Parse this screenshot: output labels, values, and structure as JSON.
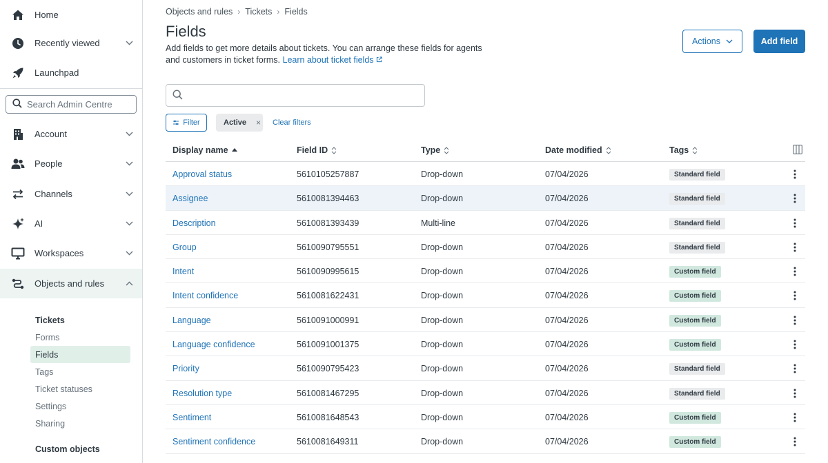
{
  "sidebar": {
    "items": [
      {
        "label": "Home",
        "icon": "home-icon"
      },
      {
        "label": "Recently viewed",
        "icon": "clock-icon"
      },
      {
        "label": "Launchpad",
        "icon": "rocket-icon"
      },
      {
        "label": "Account",
        "icon": "building-icon"
      },
      {
        "label": "People",
        "icon": "people-icon"
      },
      {
        "label": "Channels",
        "icon": "arrows-icon"
      },
      {
        "label": "AI",
        "icon": "sparkle-icon"
      },
      {
        "label": "Workspaces",
        "icon": "monitor-icon"
      },
      {
        "label": "Objects and rules",
        "icon": "objects-icon"
      }
    ],
    "search_placeholder": "Search Admin Centre",
    "section_tickets": "Tickets",
    "sub_items": [
      "Forms",
      "Fields",
      "Tags",
      "Ticket statuses",
      "Settings",
      "Sharing"
    ],
    "section_custom": "Custom objects"
  },
  "breadcrumb": [
    "Objects and rules",
    "Tickets",
    "Fields"
  ],
  "page": {
    "title": "Fields",
    "description": "Add fields to get more details about tickets. You can arrange these fields for agents and customers in ticket forms.",
    "learn_link": "Learn about ticket fields",
    "actions_label": "Actions",
    "add_label": "Add field"
  },
  "filters": {
    "filter_label": "Filter",
    "active_chip": "Active",
    "clear_label": "Clear filters"
  },
  "table": {
    "headers": [
      "Display name",
      "Field ID",
      "Type",
      "Date modified",
      "Tags"
    ],
    "rows": [
      {
        "name": "Approval status",
        "id": "5610105257887",
        "type": "Drop-down",
        "date": "07/04/2026",
        "tag": "Standard field"
      },
      {
        "name": "Assignee",
        "id": "5610081394463",
        "type": "Drop-down",
        "date": "07/04/2026",
        "tag": "Standard field"
      },
      {
        "name": "Description",
        "id": "5610081393439",
        "type": "Multi-line",
        "date": "07/04/2026",
        "tag": "Standard field"
      },
      {
        "name": "Group",
        "id": "5610090795551",
        "type": "Drop-down",
        "date": "07/04/2026",
        "tag": "Standard field"
      },
      {
        "name": "Intent",
        "id": "5610090995615",
        "type": "Drop-down",
        "date": "07/04/2026",
        "tag": "Custom field"
      },
      {
        "name": "Intent confidence",
        "id": "5610081622431",
        "type": "Drop-down",
        "date": "07/04/2026",
        "tag": "Custom field"
      },
      {
        "name": "Language",
        "id": "5610091000991",
        "type": "Drop-down",
        "date": "07/04/2026",
        "tag": "Custom field"
      },
      {
        "name": "Language confidence",
        "id": "5610091001375",
        "type": "Drop-down",
        "date": "07/04/2026",
        "tag": "Custom field"
      },
      {
        "name": "Priority",
        "id": "5610090795423",
        "type": "Drop-down",
        "date": "07/04/2026",
        "tag": "Standard field"
      },
      {
        "name": "Resolution type",
        "id": "5610081467295",
        "type": "Drop-down",
        "date": "07/04/2026",
        "tag": "Standard field"
      },
      {
        "name": "Sentiment",
        "id": "5610081648543",
        "type": "Drop-down",
        "date": "07/04/2026",
        "tag": "Custom field"
      },
      {
        "name": "Sentiment confidence",
        "id": "5610081649311",
        "type": "Drop-down",
        "date": "07/04/2026",
        "tag": "Custom field"
      }
    ]
  },
  "colors": {
    "accent": "#1f73b7",
    "active_nav": "#edf4f2",
    "custom_tag": "#d1e8df"
  }
}
